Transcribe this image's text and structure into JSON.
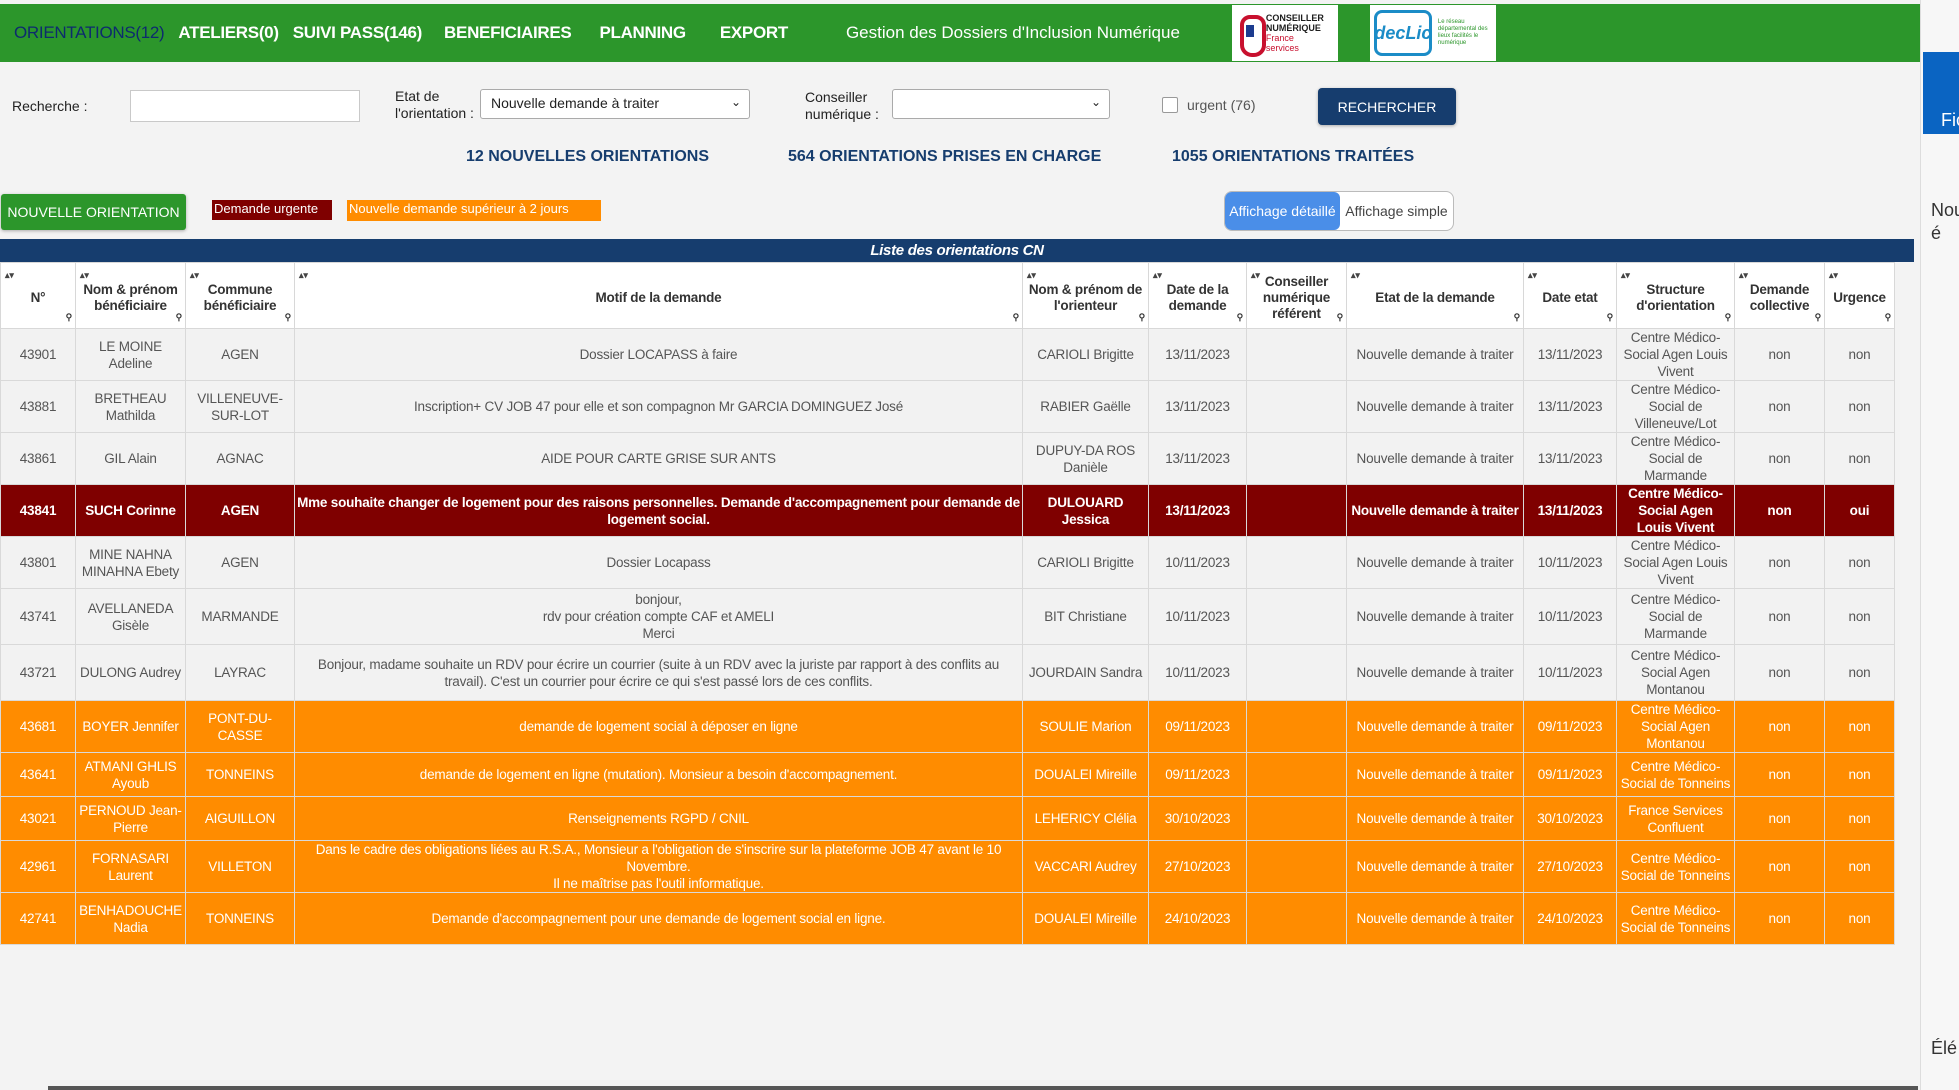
{
  "nav": {
    "items": [
      {
        "label": "ORIENTATIONS(12)",
        "active": true
      },
      {
        "label": "ATELIERS(0)"
      },
      {
        "label": "SUIVI PASS(146)"
      },
      {
        "label": "BENEFICIAIRES"
      },
      {
        "label": "PLANNING"
      },
      {
        "label": "EXPORT"
      }
    ],
    "title": "Gestion des Dossiers d'Inclusion Numérique",
    "logo1": {
      "line1": "CONSEILLER",
      "line2": "NUMÉRIQUE",
      "line3": "France",
      "line4": "services"
    },
    "logo2": {
      "badge": "decLic",
      "sub": "Le réseau départemental des lieux facilités le numérique"
    }
  },
  "search": {
    "label": "Recherche :",
    "value": "",
    "etat_label_1": "Etat de",
    "etat_label_2": "l'orientation :",
    "etat_value": "Nouvelle demande à traiter",
    "conseiller_label_1": "Conseiller",
    "conseiller_label_2": "numérique :",
    "conseiller_value": "",
    "urgent_label": "urgent (76)",
    "button": "RECHERCHER"
  },
  "stats": {
    "new": "12 NOUVELLES ORIENTATIONS",
    "taken": "564 ORIENTATIONS PRISES EN CHARGE",
    "done": "1055 ORIENTATIONS TRAITÉES"
  },
  "actions": {
    "new_button": "NOUVELLE ORIENTATION",
    "legend_urgent": "Demande urgente",
    "legend_late": "Nouvelle demande supérieur à 2 jours",
    "view_detailed": "Affichage détaillé",
    "view_simple": "Affichage simple"
  },
  "colors": {
    "green": "#2c962b",
    "navy": "#163d6e",
    "urgent": "#7f0000",
    "late": "#ff8c00"
  },
  "table": {
    "caption": "Liste des orientations CN",
    "headers": [
      "N°",
      "Nom & prénom bénéficiaire",
      "Commune bénéficiaire",
      "Motif de la demande",
      "Nom & prénom de l'orienteur",
      "Date de la demande",
      "Conseiller numérique référent",
      "Etat de la demande",
      "Date etat",
      "Structure d'orientation",
      "Demande collective",
      "Urgence"
    ],
    "rows": [
      {
        "type": "normal",
        "cells": [
          "43901",
          "LE MOINE Adeline",
          "AGEN",
          "Dossier LOCAPASS à faire",
          "CARIOLI Brigitte",
          "13/11/2023",
          "",
          "Nouvelle demande à traiter",
          "13/11/2023",
          "Centre Médico-Social Agen Louis Vivent",
          "non",
          "non"
        ]
      },
      {
        "type": "normal",
        "cells": [
          "43881",
          "BRETHEAU Mathilda",
          "VILLENEUVE-SUR-LOT",
          "Inscription+ CV JOB 47 pour elle et son compagnon Mr GARCIA DOMINGUEZ José",
          "RABIER Gaëlle",
          "13/11/2023",
          "",
          "Nouvelle demande à traiter",
          "13/11/2023",
          "Centre Médico-Social de Villeneuve/Lot",
          "non",
          "non"
        ]
      },
      {
        "type": "normal",
        "cells": [
          "43861",
          "GIL Alain",
          "AGNAC",
          "AIDE POUR CARTE GRISE SUR ANTS",
          "DUPUY-DA ROS Danièle",
          "13/11/2023",
          "",
          "Nouvelle demande à traiter",
          "13/11/2023",
          "Centre Médico-Social de Marmande",
          "non",
          "non"
        ]
      },
      {
        "type": "urgent",
        "cells": [
          "43841",
          "SUCH Corinne",
          "AGEN",
          "Mme souhaite changer de logement pour des raisons personnelles. Demande d'accompagnement pour demande de logement social.",
          "DULOUARD Jessica",
          "13/11/2023",
          "",
          "Nouvelle demande à traiter",
          "13/11/2023",
          "Centre Médico-Social Agen Louis Vivent",
          "non",
          "oui"
        ]
      },
      {
        "type": "normal",
        "cells": [
          "43801",
          "MINE NAHNA MINAHNA Ebety",
          "AGEN",
          "Dossier Locapass",
          "CARIOLI Brigitte",
          "10/11/2023",
          "",
          "Nouvelle demande à traiter",
          "10/11/2023",
          "Centre Médico-Social Agen Louis Vivent",
          "non",
          "non"
        ]
      },
      {
        "type": "normal tall",
        "cells": [
          "43741",
          "AVELLANEDA Gisèle",
          "MARMANDE",
          "bonjour,\nrdv pour création compte CAF et AMELI\nMerci",
          "BIT Christiane",
          "10/11/2023",
          "",
          "Nouvelle demande à traiter",
          "10/11/2023",
          "Centre Médico-Social de Marmande",
          "non",
          "non"
        ]
      },
      {
        "type": "normal tall",
        "cells": [
          "43721",
          "DULONG Audrey",
          "LAYRAC",
          "Bonjour, madame souhaite un RDV pour écrire un courrier (suite à un RDV avec la juriste par rapport à des conflits au travail). C'est un courrier pour écrire ce qui s'est passé lors de ces conflits.",
          "JOURDAIN Sandra",
          "10/11/2023",
          "",
          "Nouvelle demande à traiter",
          "10/11/2023",
          "Centre Médico-Social Agen Montanou",
          "non",
          "non"
        ]
      },
      {
        "type": "late",
        "cells": [
          "43681",
          "BOYER Jennifer",
          "PONT-DU-CASSE",
          "demande de logement social à déposer en ligne",
          "SOULIE Marion",
          "09/11/2023",
          "",
          "Nouvelle demande à traiter",
          "09/11/2023",
          "Centre Médico-Social Agen Montanou",
          "non",
          "non"
        ]
      },
      {
        "type": "late short",
        "cells": [
          "43641",
          "ATMANI GHLIS Ayoub",
          "TONNEINS",
          "demande de logement en ligne (mutation). Monsieur a besoin d'accompagnement.",
          "DOUALEI Mireille",
          "09/11/2023",
          "",
          "Nouvelle demande à traiter",
          "09/11/2023",
          "Centre Médico-Social de Tonneins",
          "non",
          "non"
        ]
      },
      {
        "type": "late short",
        "cells": [
          "43021",
          "PERNOUD Jean-Pierre",
          "AIGUILLON",
          "Renseignements RGPD / CNIL",
          "LEHERICY Clélia",
          "30/10/2023",
          "",
          "Nouvelle demande à traiter",
          "30/10/2023",
          "France Services Confluent",
          "non",
          "non"
        ]
      },
      {
        "type": "late",
        "cells": [
          "42961",
          "FORNASARI Laurent",
          "VILLETON",
          "Dans le cadre des obligations liées au R.S.A., Monsieur a l'obligation de s'inscrire sur la plateforme JOB 47 avant le 10 Novembre.\nIl ne maîtrise pas l'outil informatique.",
          "VACCARI Audrey",
          "27/10/2023",
          "",
          "Nouvelle demande à traiter",
          "27/10/2023",
          "Centre Médico-Social de Tonneins",
          "non",
          "non"
        ]
      },
      {
        "type": "late",
        "cells": [
          "42741",
          "BENHADOUCHE Nadia",
          "TONNEINS",
          "Demande d'accompagnement pour une demande de logement social en ligne.",
          "DOUALEI Mireille",
          "24/10/2023",
          "",
          "Nouvelle demande à traiter",
          "24/10/2023",
          "Centre Médico-Social de Tonneins",
          "non",
          "non"
        ]
      }
    ]
  },
  "side_panel": {
    "tab": "Fic",
    "text1": "Nou",
    "text2": "é",
    "text3": "Élé"
  }
}
